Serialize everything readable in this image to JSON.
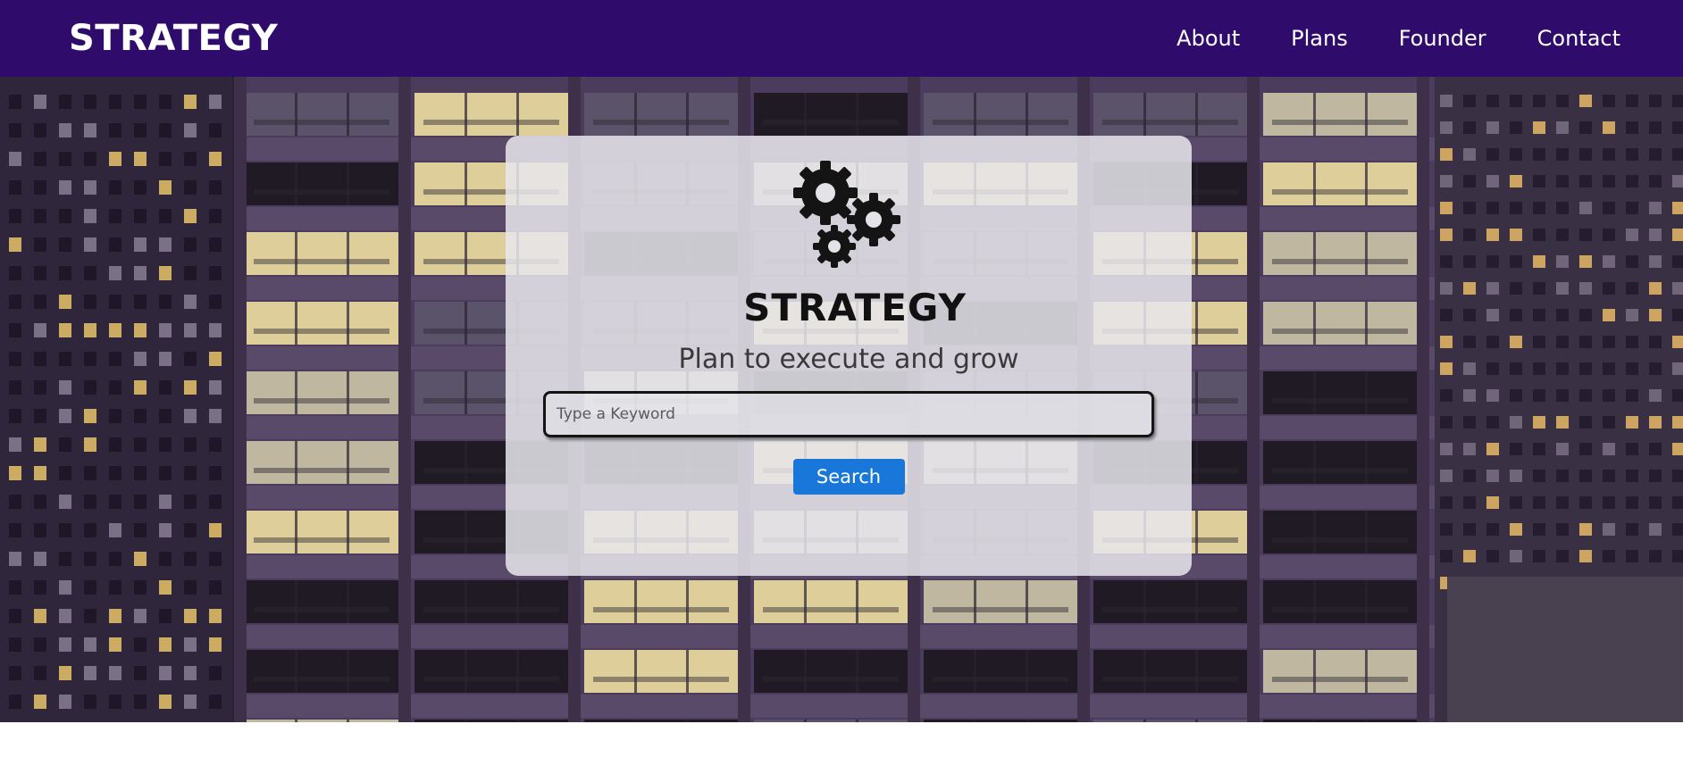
{
  "header": {
    "brand": "STRATEGY",
    "nav": [
      "About",
      "Plans",
      "Founder",
      "Contact"
    ]
  },
  "hero": {
    "icon": "gears-icon",
    "title": "STRATEGY",
    "subtitle": "Plan to execute and grow",
    "search": {
      "placeholder": "Type a Keyword",
      "value": "",
      "button_label": "Search"
    }
  },
  "colors": {
    "header_bg": "#2f0b6b",
    "button_bg": "#1877d9",
    "card_bg": "#e8e7ec"
  }
}
